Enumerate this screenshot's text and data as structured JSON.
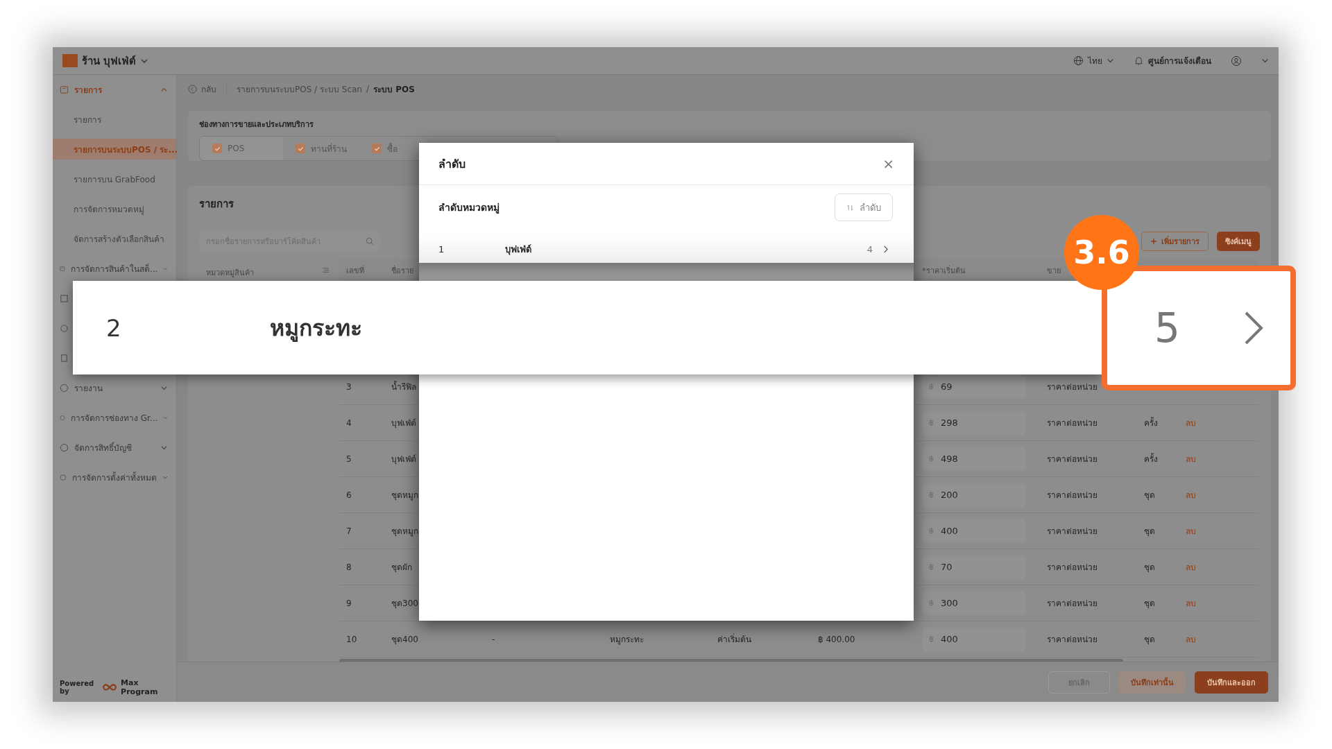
{
  "header": {
    "store": "ร้าน บุฟเฟ่ต์",
    "language": "ไทย",
    "notifications": "ศูนย์การแจ้งเตือน"
  },
  "sidebar": {
    "top_items": [
      {
        "label": "รายการ",
        "expanded": true,
        "selected": true,
        "children": [
          {
            "label": "รายการ",
            "selected": false
          },
          {
            "label": "รายการบนระบบPOS / ระ...",
            "selected": true
          },
          {
            "label": "รายการบน GrabFood",
            "selected": false
          },
          {
            "label": "การจัดการหมวดหมู่",
            "selected": false
          },
          {
            "label": "จัดการสร้างตัวเลือกสินค้า",
            "selected": false
          }
        ]
      },
      {
        "label": "การจัดการสินค้าในสต็...",
        "expanded": false,
        "selected": false
      }
    ],
    "bottom_items": [
      {
        "label": "รายงาน",
        "expanded": false,
        "selected": false
      },
      {
        "label": "การจัดการช่องทาง Gr...",
        "expanded": false,
        "selected": false
      },
      {
        "label": "จัดการสิทธิ์บัญชี",
        "expanded": false,
        "selected": false
      },
      {
        "label": "การจัดการตั้งค่าทั้งหมด",
        "expanded": false,
        "selected": false
      }
    ],
    "powered_by": "Powered by",
    "brand": "Max Program"
  },
  "breadcrumb": {
    "back": "กลับ",
    "trail": "รายการบนระบบPOS / ระบบ Scan",
    "separator": "/",
    "current": "ระบบ POS"
  },
  "channels": {
    "title": "ช่องทางการขายและประเภทบริการ",
    "options": [
      {
        "label": "POS",
        "checked": true
      },
      {
        "label": "ทานที่ร้าน",
        "checked": true
      },
      {
        "label": "ซื้อ",
        "checked": true
      }
    ]
  },
  "items": {
    "title": "รายการ",
    "search": {
      "placeholder": "กรอกชื่อรายการหรือบาร์โค้ดสินค้า"
    },
    "add_button": "เพิ่มรายการ",
    "sync_button": "ซิงค์เมนู",
    "category_header": "หมวดหมู่สินค้า",
    "header": {
      "no": "เลขที่",
      "name": "ชื่อราย",
      "price": "*ราคาเริ่มต้น",
      "pricing": "ขาย"
    },
    "rows": [
      {
        "no": "3",
        "name": "น้ำรีฟิล",
        "currency": "฿",
        "price": "69",
        "pricing": "ราคาต่อหน่วย"
      },
      {
        "no": "4",
        "name": "บุฟเฟ่ต์",
        "currency": "฿",
        "price": "298",
        "pricing": "ราคาต่อหน่วย",
        "unit": "ครั้ง",
        "delete": "ลบ"
      },
      {
        "no": "5",
        "name": "บุฟเฟ่ต์",
        "currency": "฿",
        "price": "498",
        "pricing": "ราคาต่อหน่วย",
        "unit": "ครั้ง",
        "delete": "ลบ"
      },
      {
        "no": "6",
        "name": "ชุดหมูก",
        "currency": "฿",
        "price": "200",
        "pricing": "ราคาต่อหน่วย",
        "unit": "ชุด",
        "delete": "ลบ"
      },
      {
        "no": "7",
        "name": "ชุดหมูก",
        "currency": "฿",
        "price": "400",
        "pricing": "ราคาต่อหน่วย",
        "unit": "ชุด",
        "delete": "ลบ"
      },
      {
        "no": "8",
        "name": "ชุดผัก",
        "currency": "฿",
        "price": "70",
        "pricing": "ราคาต่อหน่วย",
        "unit": "ชุด",
        "delete": "ลบ"
      },
      {
        "no": "9",
        "name": "ชุด300",
        "currency": "฿",
        "price": "300",
        "pricing": "ราคาต่อหน่วย",
        "unit": "ชุด",
        "delete": "ลบ"
      },
      {
        "no": "10",
        "name": "ชุด400",
        "column_3": "-",
        "category": "หมูกระทะ",
        "column_5": "ค่าเริ่มต้น",
        "column_6": "฿ 400.00",
        "currency": "฿",
        "price": "400",
        "pricing": "ราคาต่อหน่วย",
        "unit": "ชุด",
        "delete": "ลบ"
      }
    ]
  },
  "footer": {
    "cancel": "ยกเลิก",
    "save": "บันทึกเท่านั้น",
    "save_exit": "บันทึกและออก"
  },
  "modal": {
    "title": "ลำดับ",
    "close": "×",
    "section": "ลำดับหมวดหมู่",
    "sort_button": "ลำดับ",
    "rows": [
      {
        "no": "1",
        "name": "บุฟเฟ่ต์",
        "count": "4"
      }
    ]
  },
  "callout": {
    "no": "2",
    "name": "หมูกระทะ",
    "count": "5",
    "step": "3.6"
  }
}
